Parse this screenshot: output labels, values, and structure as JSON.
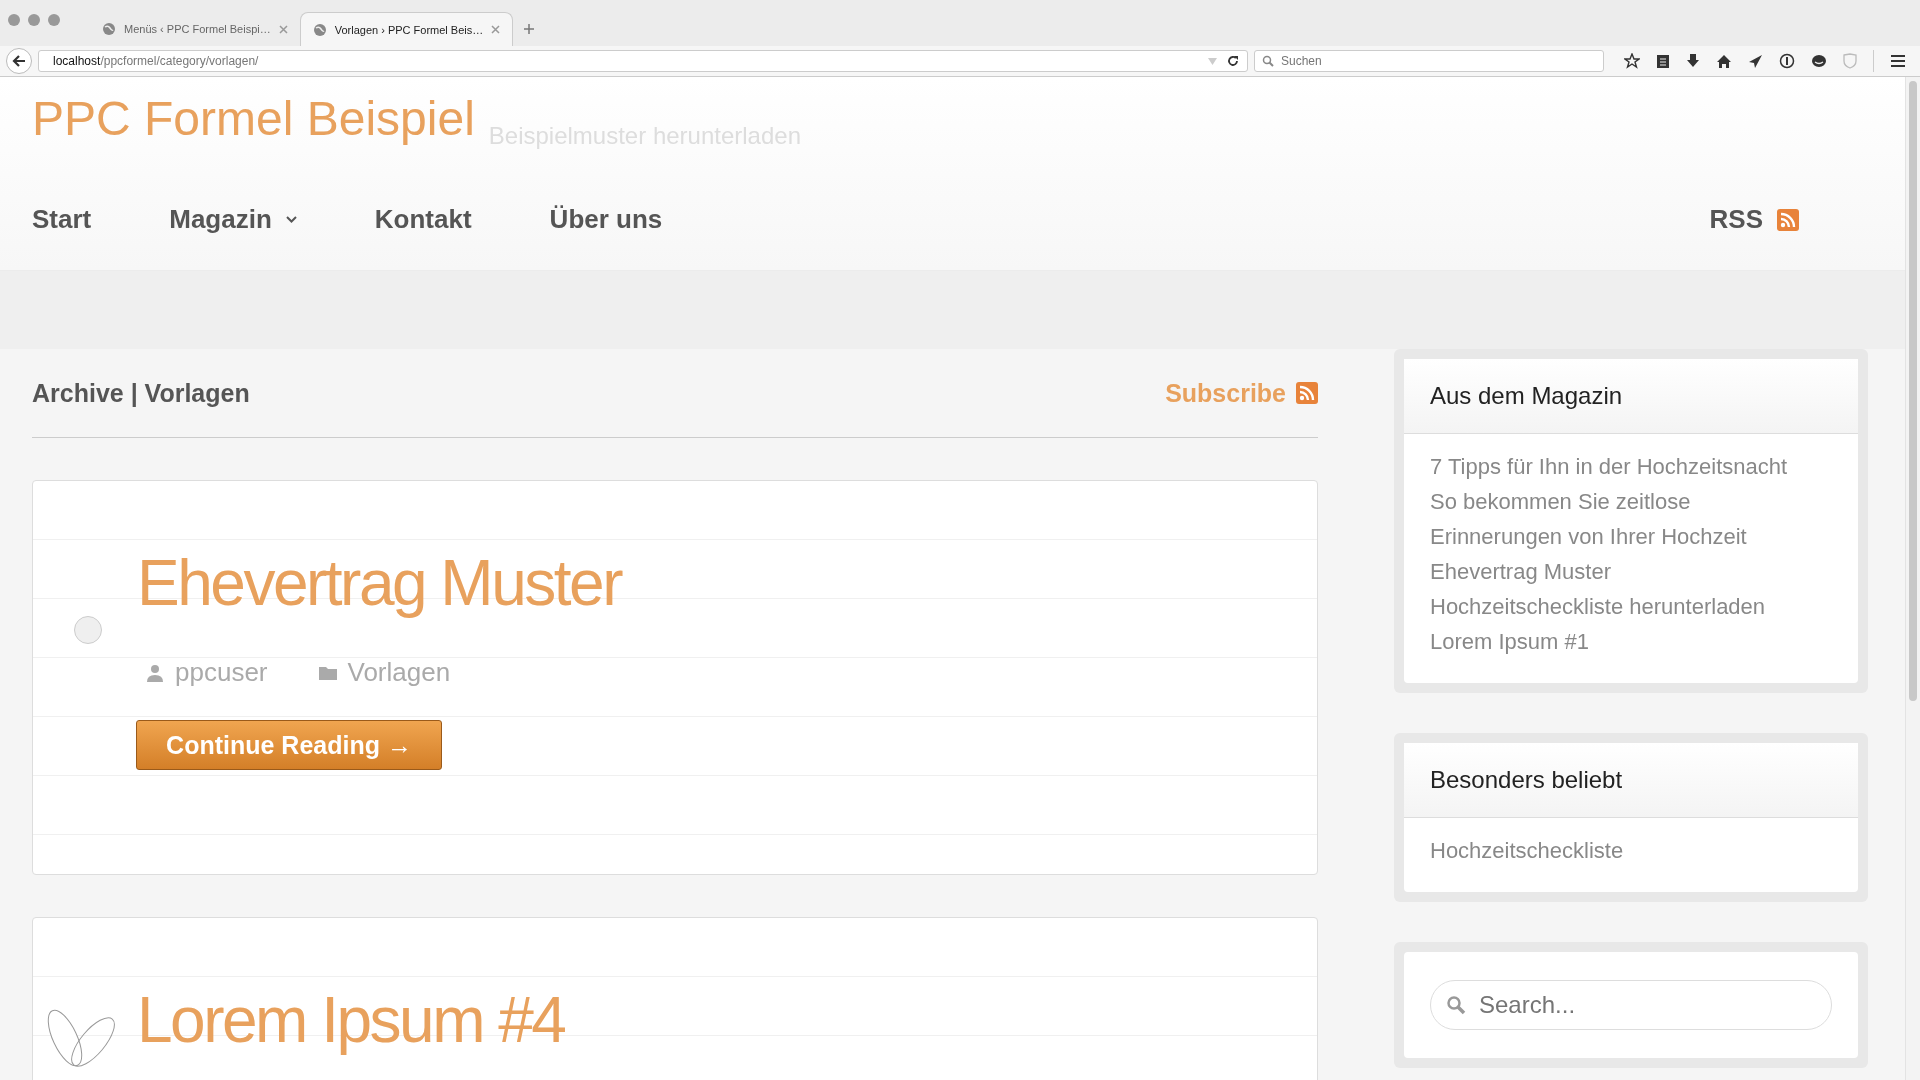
{
  "browser": {
    "tabs": [
      {
        "title": "Menüs ‹ PPC Formel Beispi…",
        "selected": false
      },
      {
        "title": "Vorlagen › PPC Formel Beis…",
        "selected": true
      }
    ],
    "url_host": "localhost",
    "url_path": "/ppcformel/category/vorlagen/",
    "search": {
      "placeholder": "Suchen"
    }
  },
  "site": {
    "title": "PPC Formel Beispiel",
    "tagline": "Beispielmuster herunterladen",
    "nav": [
      {
        "label": "Start",
        "dropdown": false
      },
      {
        "label": "Magazin",
        "dropdown": true
      },
      {
        "label": "Kontakt",
        "dropdown": false
      },
      {
        "label": "Über uns",
        "dropdown": false
      }
    ],
    "rss": "RSS"
  },
  "archive": {
    "heading": "Archive | Vorlagen",
    "subscribe": "Subscribe"
  },
  "posts": [
    {
      "title": "Ehevertrag Muster",
      "kind": "dot",
      "author": "ppcuser",
      "category": "Vorlagen",
      "button": "Continue Reading →"
    },
    {
      "title": "Lorem Ipsum #4",
      "kind": "rings"
    }
  ],
  "sidebar": [
    {
      "kind": "list",
      "title": "Aus dem Magazin",
      "items": [
        "7 Tipps für Ihn in der Hochzeitsnacht",
        "So bekommen Sie zeitlose",
        "Erinnerungen von Ihrer Hochzeit",
        "Ehevertrag Muster",
        "Hochzeitscheckliste herunterladen",
        "Lorem Ipsum #1"
      ]
    },
    {
      "kind": "list",
      "title": "Besonders beliebt",
      "items": [
        "Hochzeitscheckliste"
      ]
    },
    {
      "kind": "search",
      "placeholder": "Search..."
    }
  ]
}
